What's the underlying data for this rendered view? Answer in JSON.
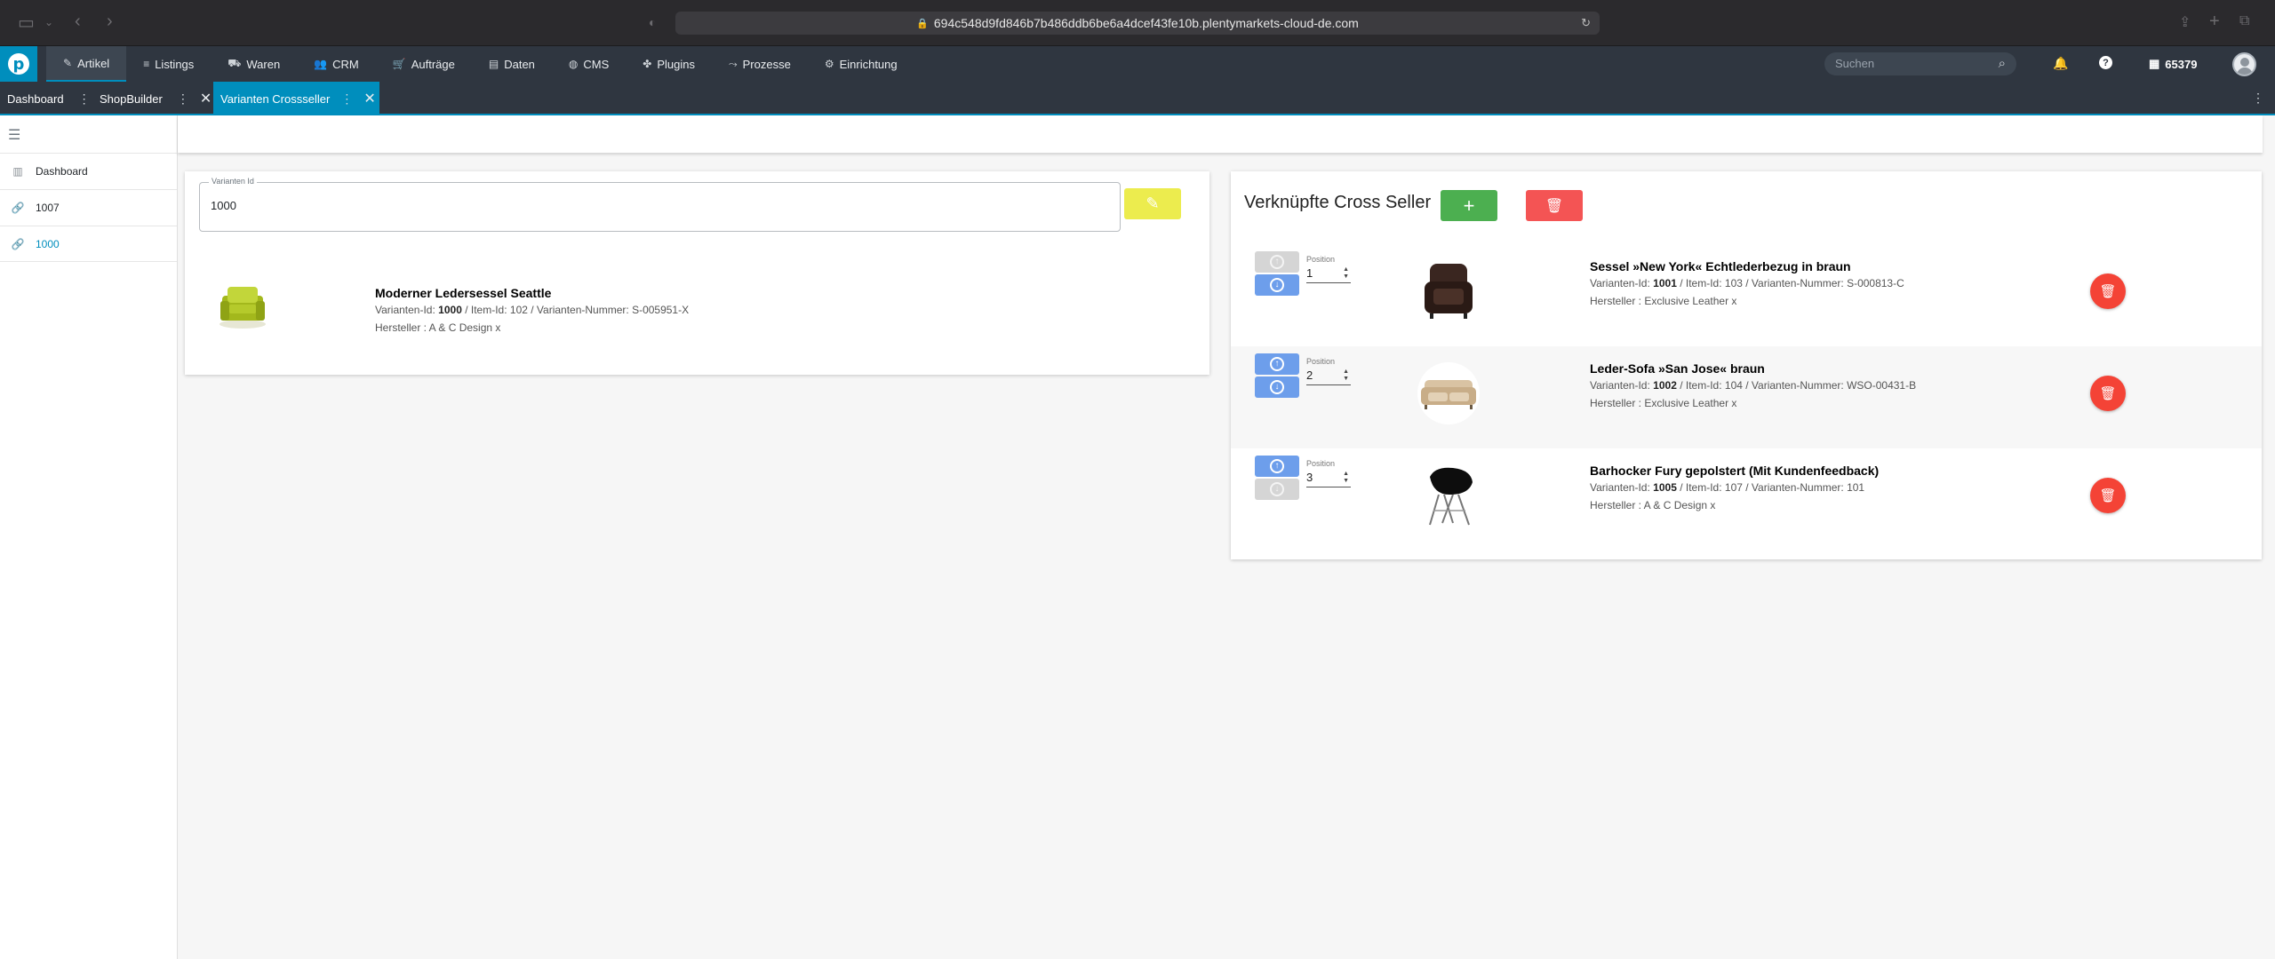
{
  "browser": {
    "url": "694c548d9fd846b7b486ddb6be6a4dcef43fe10b.plentymarkets-cloud-de.com"
  },
  "topnav": {
    "items": [
      {
        "label": "Artikel",
        "icon": "tag-icon",
        "glyph": "✎",
        "active": true
      },
      {
        "label": "Listings",
        "icon": "listings-icon",
        "glyph": "≡",
        "active": false
      },
      {
        "label": "Waren",
        "icon": "truck-icon",
        "glyph": "⛟",
        "active": false
      },
      {
        "label": "CRM",
        "icon": "users-icon",
        "glyph": "👥",
        "active": false
      },
      {
        "label": "Aufträge",
        "icon": "cart-icon",
        "glyph": "🛒",
        "active": false
      },
      {
        "label": "Daten",
        "icon": "database-icon",
        "glyph": "▤",
        "active": false
      },
      {
        "label": "CMS",
        "icon": "globe-icon",
        "glyph": "◍",
        "active": false
      },
      {
        "label": "Plugins",
        "icon": "puzzle-icon",
        "glyph": "✤",
        "active": false
      },
      {
        "label": "Prozesse",
        "icon": "process-icon",
        "glyph": "⤳",
        "active": false
      },
      {
        "label": "Einrichtung",
        "icon": "gear-icon",
        "glyph": "⚙",
        "active": false
      }
    ],
    "search_placeholder": "Suchen",
    "account_id": "65379"
  },
  "tabs": [
    {
      "label": "Dashboard",
      "closable": false,
      "active": false
    },
    {
      "label": "ShopBuilder",
      "closable": true,
      "active": false
    },
    {
      "label": "Varianten Crossseller",
      "closable": true,
      "active": true
    }
  ],
  "sidebar": {
    "items": [
      {
        "label": "Dashboard",
        "icon": "chart-icon",
        "active": false
      },
      {
        "label": "1007",
        "icon": "link-icon",
        "active": false
      },
      {
        "label": "1000",
        "icon": "link-icon",
        "active": true
      }
    ]
  },
  "variant": {
    "field_label": "Varianten Id",
    "field_value": "1000",
    "product": {
      "title": "Moderner Ledersessel Seattle",
      "variant_id_label": "Varianten-Id:",
      "variant_id": "1000",
      "rest": "/ Item-Id: 102 / Varianten-Nummer: S-005951-X",
      "maker": "Hersteller : A & C Design x"
    }
  },
  "crossseller": {
    "title": "Verknüpfte Cross Seller",
    "position_label": "Position",
    "rows": [
      {
        "position": "1",
        "name": "Sessel »New York« Echtlederbezug in braun",
        "variant_id_label": "Varianten-Id:",
        "variant_id": "1001",
        "rest": "/ Item-Id: 103 / Varianten-Nummer: S-000813-C",
        "maker": "Hersteller : Exclusive Leather x",
        "up_enabled": false,
        "down_enabled": true
      },
      {
        "position": "2",
        "name": "Leder-Sofa »San Jose« braun",
        "variant_id_label": "Varianten-Id:",
        "variant_id": "1002",
        "rest": "/ Item-Id: 104 / Varianten-Nummer: WSO-00431-B",
        "maker": "Hersteller : Exclusive Leather x",
        "up_enabled": true,
        "down_enabled": true
      },
      {
        "position": "3",
        "name": "Barhocker Fury gepolstert (Mit Kundenfeedback)",
        "variant_id_label": "Varianten-Id:",
        "variant_id": "1005",
        "rest": "/ Item-Id: 107 / Varianten-Nummer: 101",
        "maker": "Hersteller : A & C Design x",
        "up_enabled": true,
        "down_enabled": false
      }
    ]
  },
  "colors": {
    "accent": "#008ebd",
    "nav_bg": "#2f3640",
    "add": "#4caf50",
    "delete": "#f44336",
    "edit": "#ecec4e",
    "arrow": "#6d9eeb"
  }
}
